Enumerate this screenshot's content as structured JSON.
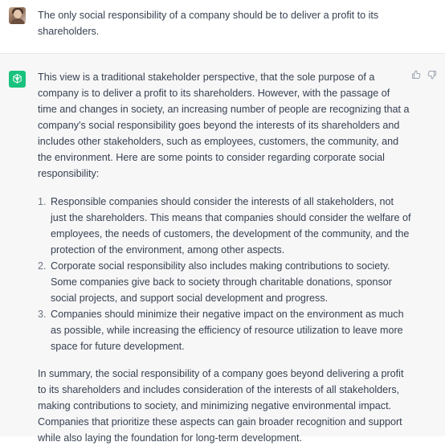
{
  "user_message": {
    "text": "The only social responsibility of a company should be to deliver a profit to its shareholders."
  },
  "assistant_message": {
    "intro": "This view is a traditional stakeholder perspective, that the sole purpose of a company is to deliver a profit to its shareholders. However, with the passage of time and changes in society, an increasing number of people are recognizing that a company's social responsibility goes beyond the interests of its shareholders and includes other stakeholders, such as employees, customers, the community, and the environment. Here are some points to consider regarding corporate social responsibility:",
    "points": [
      {
        "num": "1.",
        "text": "Responsible companies should consider the interests of all stakeholders, not just the shareholders. This means that companies should consider the welfare of employees, the needs of customers, the development of the community, and the protection of the environment, among other aspects."
      },
      {
        "num": "2.",
        "text": "Corporate social responsibility also includes making contributions to society. Some companies give back to society through charitable donations, sponsor social projects, and support social development and progress."
      },
      {
        "num": "3.",
        "text": "Companies should minimize their negative impact on the environment as much as possible, while increasing the efficiency of resource utilization to leave more space for future development."
      }
    ],
    "summary": "In summary, the social responsibility of a company goes beyond delivering a profit to its shareholders and includes consideration of the interests of all stakeholders, making contributions to society, and minimizing negative environmental impact. Companies that prioritize these aspects can gain broader recognition and support while also laying the foundation for long-term development."
  },
  "icons": {
    "user_avatar": "user-avatar",
    "assistant_avatar": "openai-logo-icon",
    "thumbs_up": "thumbs-up-icon",
    "thumbs_down": "thumbs-down-icon"
  },
  "colors": {
    "assistant_avatar_bg": "#19c37d",
    "assistant_row_bg": "#f7f7f8",
    "text": "#374151"
  }
}
